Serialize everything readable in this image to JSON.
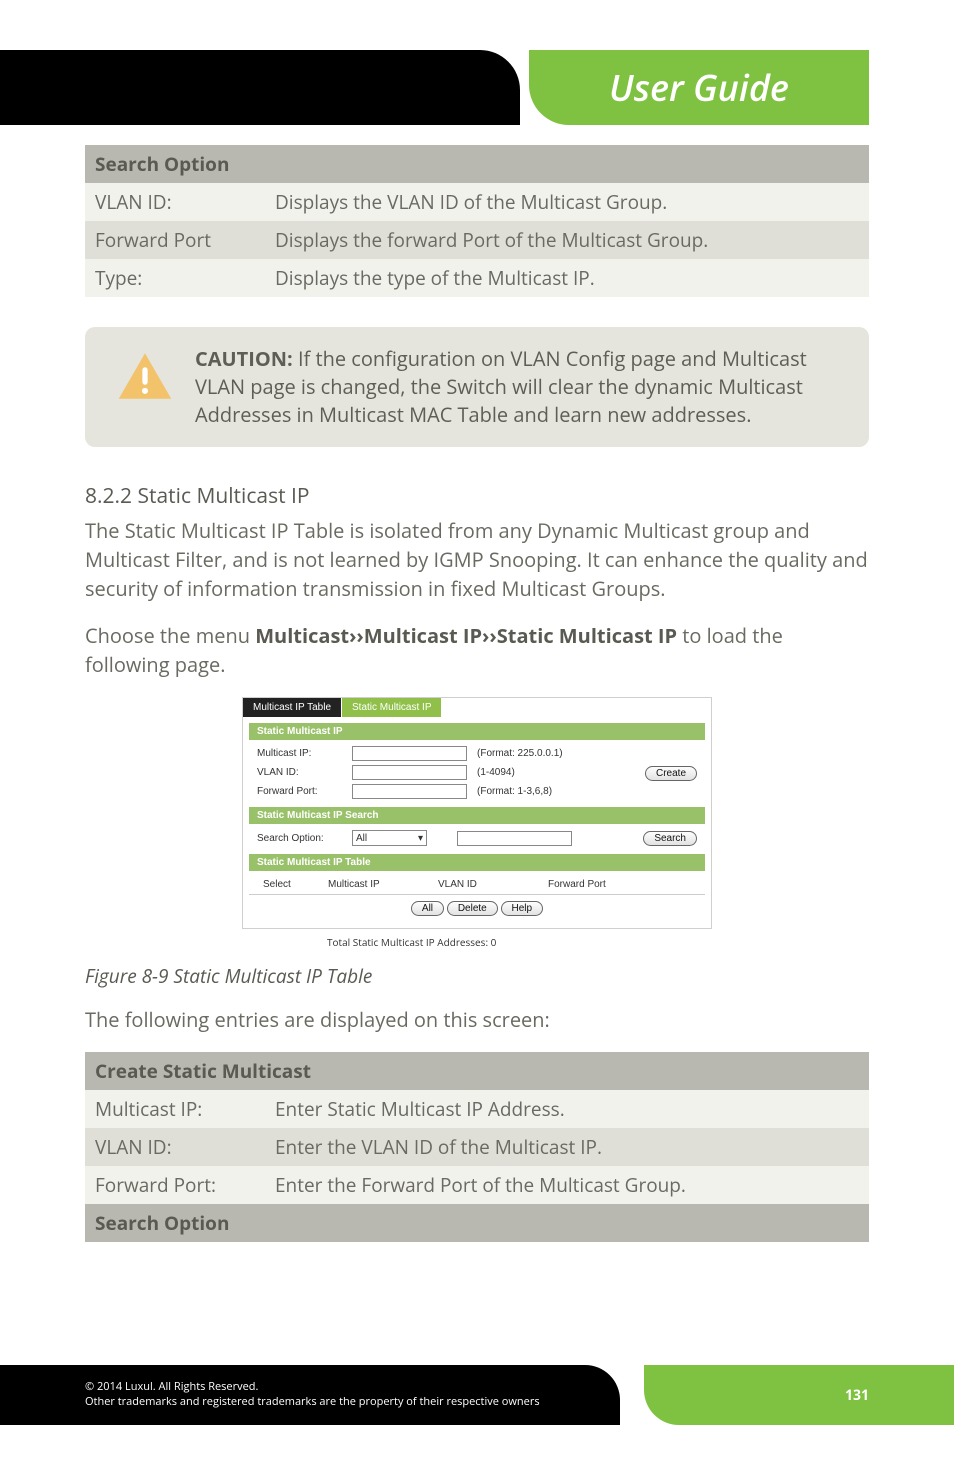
{
  "header": {
    "title": "User Guide"
  },
  "table1": {
    "header": "Search Option",
    "rows": [
      {
        "label": "VLAN ID:",
        "desc": "Displays the VLAN ID of the Multicast Group."
      },
      {
        "label": "Forward Port",
        "desc": "Displays the forward Port of the Multicast Group."
      },
      {
        "label": "Type:",
        "desc": "Displays the type of the Multicast IP."
      }
    ]
  },
  "caution": {
    "label": "CAUTION:",
    "text": " If the configuration on VLAN Config page and Multicast VLAN page is changed, the Switch will clear the dynamic Multicast Addresses in Multicast MAC Table and learn new addresses."
  },
  "section": {
    "heading": "8.2.2 Static Multicast IP",
    "p1": "The Static Multicast IP Table is isolated from any Dynamic Multicast group and Multicast Filter, and is not learned by IGMP Snooping. It can enhance the quality and security of information transmission in fixed Multicast Groups.",
    "p2a": "Choose the menu ",
    "p2b": "Multicast››Multicast IP››Static Multicast IP",
    "p2c": " to load the following page."
  },
  "figure": {
    "tab1": "Multicast IP Table",
    "tab2": "Static Multicast IP",
    "sec1_title": "Static Multicast IP",
    "row1_label": "Multicast IP:",
    "row1_hint": "(Format: 225.0.0.1)",
    "row2_label": "VLAN ID:",
    "row2_hint": "(1-4094)",
    "row3_label": "Forward Port:",
    "row3_hint": "(Format: 1-3,6,8)",
    "create_btn": "Create",
    "sec2_title": "Static Multicast IP Search",
    "search_label": "Search Option:",
    "select_value": "All",
    "search_btn": "Search",
    "sec3_title": "Static Multicast IP Table",
    "th1": "Select",
    "th2": "Multicast IP",
    "th3": "VLAN ID",
    "th4": "Forward Port",
    "btn_all": "All",
    "btn_delete": "Delete",
    "btn_help": "Help",
    "footer_note": "Total Static Multicast IP Addresses: 0"
  },
  "caption": "Figure 8-9 Static Multicast IP Table",
  "entries_intro": "The following entries are displayed on this screen:",
  "table2": {
    "header1": "Create Static Multicast",
    "rows": [
      {
        "label": "Multicast IP:",
        "desc": "Enter Static Multicast IP Address."
      },
      {
        "label": "VLAN ID:",
        "desc": "Enter the VLAN ID of the Multicast IP."
      },
      {
        "label": "Forward Port:",
        "desc": "Enter the Forward Port of the Multicast Group."
      }
    ],
    "header2": "Search Option"
  },
  "footer": {
    "line1": "© 2014  Luxul. All Rights Reserved.",
    "line2": "Other trademarks and registered trademarks are the property of their respective owners",
    "page": "131"
  }
}
